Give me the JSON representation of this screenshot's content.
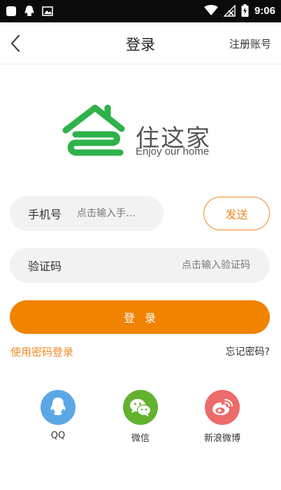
{
  "status_bar": {
    "time": "9:06"
  },
  "nav": {
    "title": "登录",
    "register": "注册账号"
  },
  "brand": {
    "name": "住这家",
    "slogan": "Enjoy our home",
    "logo_color": "#2eb24a"
  },
  "form": {
    "phone_label": "手机号",
    "phone_placeholder": "点击输入手…",
    "send_label": "发送",
    "code_label": "验证码",
    "code_placeholder": "点击输入验证码",
    "login_label": "登录",
    "password_login": "使用密码登录",
    "forgot_password": "忘记密码?"
  },
  "social": [
    {
      "label": "QQ",
      "icon": "qq-icon",
      "color": "#5ba7e6"
    },
    {
      "label": "微信",
      "icon": "wechat-icon",
      "color": "#62b22f"
    },
    {
      "label": "新浪微博",
      "icon": "weibo-icon",
      "color": "#ec6b6b"
    }
  ],
  "colors": {
    "accent": "#f08300",
    "field_bg": "#f2f2f2"
  }
}
